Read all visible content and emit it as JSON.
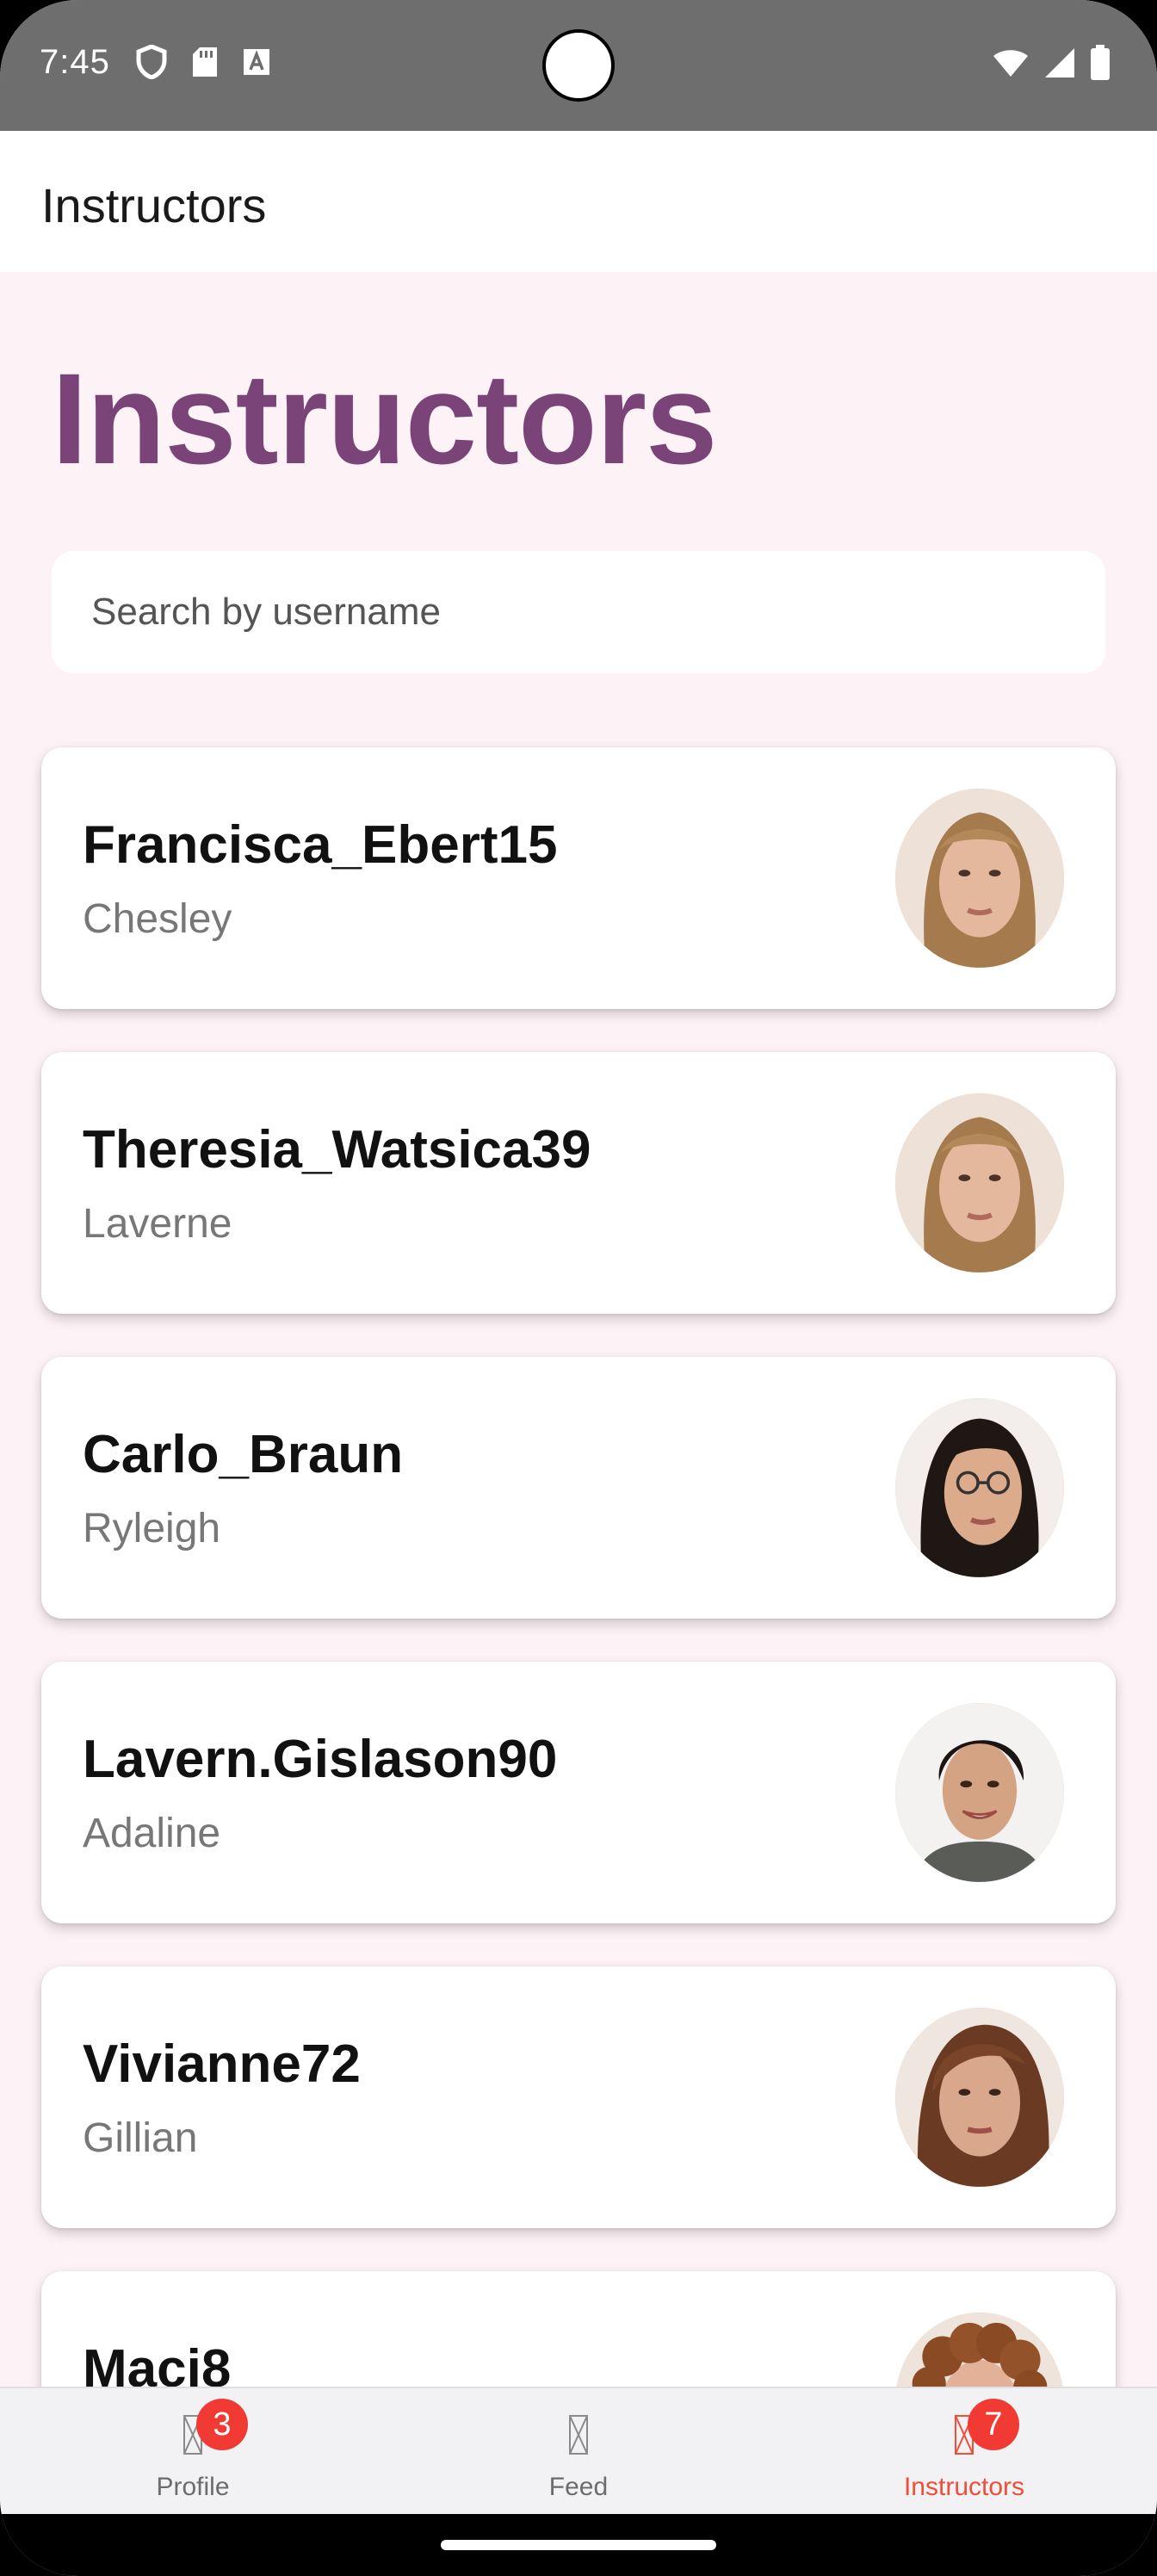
{
  "status_bar": {
    "time": "7:45",
    "left_icons": [
      "shield-icon",
      "sd-card-icon",
      "a-box-icon"
    ],
    "right_icons": [
      "wifi-icon",
      "signal-icon",
      "battery-icon"
    ]
  },
  "app_bar": {
    "title": "Instructors"
  },
  "page": {
    "heading": "Instructors"
  },
  "search": {
    "placeholder": "Search by username",
    "value": ""
  },
  "instructors": [
    {
      "username": "Francisca_Ebert15",
      "name": "Chesley",
      "avatar": "woman-light-blonde"
    },
    {
      "username": "Theresia_Watsica39",
      "name": "Laverne",
      "avatar": "woman-light-blonde"
    },
    {
      "username": "Carlo_Braun",
      "name": "Ryleigh",
      "avatar": "woman-dark-hair-glasses"
    },
    {
      "username": "Lavern.Gislason90",
      "name": "Adaline",
      "avatar": "woman-dark-short-hair"
    },
    {
      "username": "Vivianne72",
      "name": "Gillian",
      "avatar": "woman-brown-hair"
    },
    {
      "username": "Maci8",
      "name": "",
      "avatar": "man-curly-hair"
    }
  ],
  "bottom_nav": {
    "items": [
      {
        "label": "Profile",
        "badge": "3",
        "active": false
      },
      {
        "label": "Feed",
        "badge": "",
        "active": false
      },
      {
        "label": "Instructors",
        "badge": "7",
        "active": true
      }
    ]
  },
  "colors": {
    "accent": "#7a4478",
    "active_nav": "#f04e38",
    "badge": "#f03a33",
    "background": "#fdf2f6"
  }
}
